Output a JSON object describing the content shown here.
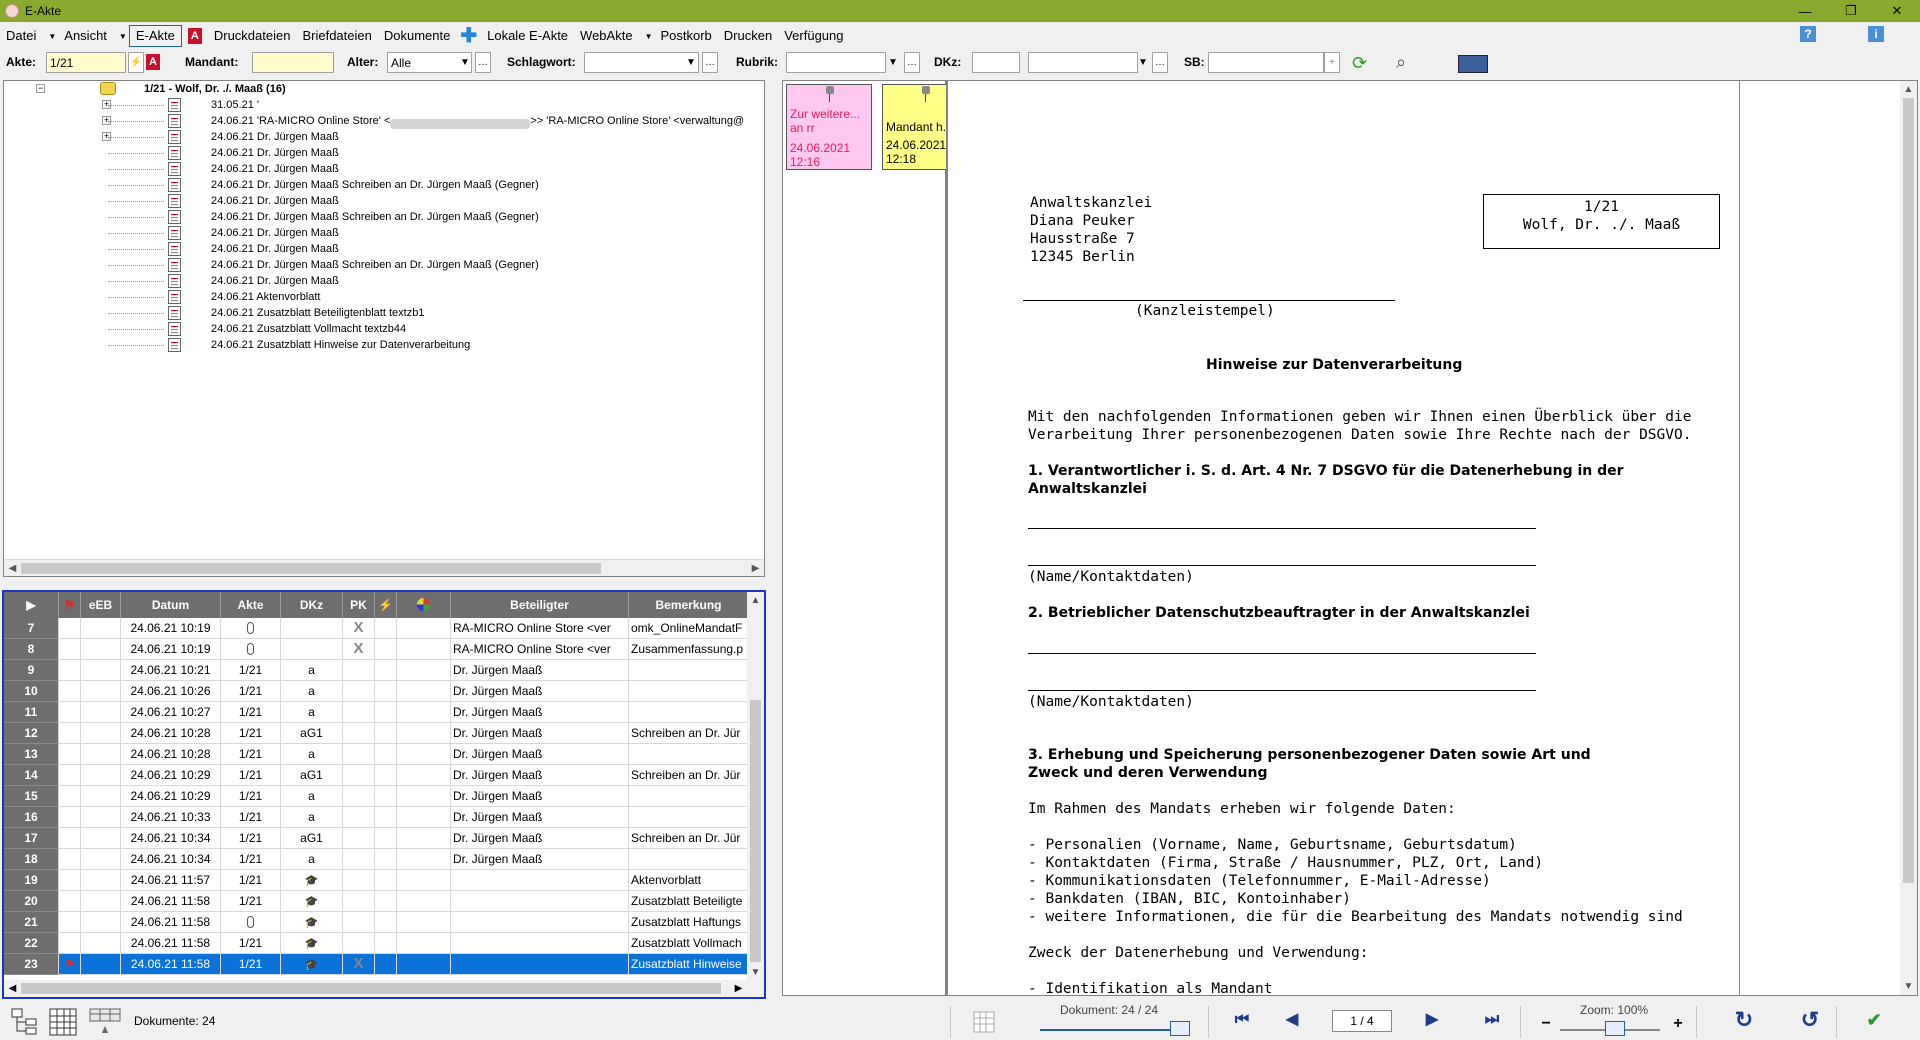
{
  "window": {
    "title": "E-Akte",
    "minimize": "—",
    "restore": "❐",
    "close": "✕"
  },
  "menu": {
    "datei": "Datei",
    "ansicht": "Ansicht",
    "eakte": "E-Akte",
    "druckdateien": "Druckdateien",
    "briefdateien": "Briefdateien",
    "dokumente": "Dokumente",
    "lokale_eakte": "Lokale E-Akte",
    "webakte": "WebAkte",
    "postkorb": "Postkorb",
    "drucken": "Drucken",
    "verfuegung": "Verfügung",
    "help": "?",
    "info": "i"
  },
  "filters": {
    "akte_label": "Akte:",
    "akte_value": "1/21",
    "mandant_label": "Mandant:",
    "mandant_value": "",
    "alter_label": "Alter:",
    "alter_value": "Alle",
    "schlagwort_label": "Schlagwort:",
    "schlagwort_value": "",
    "rubrik_label": "Rubrik:",
    "rubrik_value": "",
    "dkz_label": "DKz:",
    "dkz_value": "",
    "dkz2_value": "",
    "sb_label": "SB:",
    "sb_value": ""
  },
  "tree": {
    "root_label": "1/21 - Wolf, Dr. ./. Maaß (16)",
    "items": [
      {
        "date": "31.05.21",
        "text": "'",
        "expander": "+"
      },
      {
        "date": "24.06.21",
        "text": "'RA-MICRO Online Store' <",
        "text2": ">> 'RA-MICRO Online Store' <verwaltung@",
        "expander": "+"
      },
      {
        "date": "24.06.21",
        "text": "Dr. Jürgen Maaß",
        "expander": "+"
      },
      {
        "date": "24.06.21",
        "text": "Dr. Jürgen Maaß"
      },
      {
        "date": "24.06.21",
        "text": "Dr. Jürgen Maaß"
      },
      {
        "date": "24.06.21",
        "text": "Dr. Jürgen Maaß Schreiben an Dr. Jürgen Maaß (Gegner)"
      },
      {
        "date": "24.06.21",
        "text": "Dr. Jürgen Maaß"
      },
      {
        "date": "24.06.21",
        "text": "Dr. Jürgen Maaß Schreiben an Dr. Jürgen Maaß (Gegner)"
      },
      {
        "date": "24.06.21",
        "text": "Dr. Jürgen Maaß"
      },
      {
        "date": "24.06.21",
        "text": "Dr. Jürgen Maaß"
      },
      {
        "date": "24.06.21",
        "text": "Dr. Jürgen Maaß Schreiben an Dr. Jürgen Maaß (Gegner)"
      },
      {
        "date": "24.06.21",
        "text": "Dr. Jürgen Maaß"
      },
      {
        "date": "24.06.21",
        "text": "Aktenvorblatt"
      },
      {
        "date": "24.06.21",
        "text": "Zusatzblatt Beteiligtenblatt   textzb1"
      },
      {
        "date": "24.06.21",
        "text": "Zusatzblatt Vollmacht   textzb44"
      },
      {
        "date": "24.06.21",
        "text": "Zusatzblatt Hinweise zur Datenverarbeitung"
      }
    ]
  },
  "grid": {
    "headers": {
      "play": "▶",
      "eeb": "eEB",
      "datum": "Datum",
      "akte": "Akte",
      "dkz": "DKz",
      "pk": "PK",
      "beteiligter": "Beteiligter",
      "bemerkung": "Bemerkung"
    },
    "rows": [
      {
        "num": "7",
        "datum": "24.06.21 10:19",
        "akte": "",
        "akte_icon": "clip",
        "dkz": "",
        "pk": "X",
        "beteiligter": "RA-MICRO Online Store <ver",
        "bemerkung": "omk_OnlineMandatF"
      },
      {
        "num": "8",
        "datum": "24.06.21 10:19",
        "akte": "",
        "akte_icon": "clip",
        "dkz": "",
        "pk": "X",
        "beteiligter": "RA-MICRO Online Store <ver",
        "bemerkung": "Zusammenfassung.p"
      },
      {
        "num": "9",
        "datum": "24.06.21 10:21",
        "akte": "1/21",
        "dkz": "a",
        "pk": "",
        "beteiligter": "Dr. Jürgen Maaß",
        "bemerkung": ""
      },
      {
        "num": "10",
        "datum": "24.06.21 10:26",
        "akte": "1/21",
        "dkz": "a",
        "pk": "",
        "beteiligter": "Dr. Jürgen Maaß",
        "bemerkung": ""
      },
      {
        "num": "11",
        "datum": "24.06.21 10:27",
        "akte": "1/21",
        "dkz": "a",
        "pk": "",
        "beteiligter": "Dr. Jürgen Maaß",
        "bemerkung": ""
      },
      {
        "num": "12",
        "datum": "24.06.21 10:28",
        "akte": "1/21",
        "dkz": "aG1",
        "pk": "",
        "beteiligter": "Dr. Jürgen Maaß",
        "bemerkung": "Schreiben an Dr. Jür"
      },
      {
        "num": "13",
        "datum": "24.06.21 10:28",
        "akte": "1/21",
        "dkz": "a",
        "pk": "",
        "beteiligter": "Dr. Jürgen Maaß",
        "bemerkung": ""
      },
      {
        "num": "14",
        "datum": "24.06.21 10:29",
        "akte": "1/21",
        "dkz": "aG1",
        "pk": "",
        "beteiligter": "Dr. Jürgen Maaß",
        "bemerkung": "Schreiben an Dr. Jür"
      },
      {
        "num": "15",
        "datum": "24.06.21 10:29",
        "akte": "1/21",
        "dkz": "a",
        "pk": "",
        "beteiligter": "Dr. Jürgen Maaß",
        "bemerkung": ""
      },
      {
        "num": "16",
        "datum": "24.06.21 10:33",
        "akte": "1/21",
        "dkz": "a",
        "pk": "",
        "beteiligter": "Dr. Jürgen Maaß",
        "bemerkung": ""
      },
      {
        "num": "17",
        "datum": "24.06.21 10:34",
        "akte": "1/21",
        "dkz": "aG1",
        "pk": "",
        "beteiligter": "Dr. Jürgen Maaß",
        "bemerkung": "Schreiben an Dr. Jür"
      },
      {
        "num": "18",
        "datum": "24.06.21 10:34",
        "akte": "1/21",
        "dkz": "a",
        "pk": "",
        "beteiligter": "Dr. Jürgen Maaß",
        "bemerkung": ""
      },
      {
        "num": "19",
        "datum": "24.06.21 11:57",
        "akte": "1/21",
        "dkz": "",
        "dkz_icon": "hat",
        "pk": "",
        "beteiligter": "",
        "bemerkung": "Aktenvorblatt"
      },
      {
        "num": "20",
        "datum": "24.06.21 11:58",
        "akte": "1/21",
        "dkz": "",
        "dkz_icon": "hat",
        "pk": "",
        "beteiligter": "",
        "bemerkung": "Zusatzblatt Beteiligte"
      },
      {
        "num": "21",
        "datum": "24.06.21 11:58",
        "akte": "",
        "akte_icon": "clip",
        "dkz": "",
        "dkz_icon": "hat",
        "pk": "",
        "beteiligter": "",
        "bemerkung": "Zusatzblatt Haftungs"
      },
      {
        "num": "22",
        "datum": "24.06.21 11:58",
        "akte": "1/21",
        "dkz": "",
        "dkz_icon": "hat",
        "pk": "",
        "beteiligter": "",
        "bemerkung": "Zusatzblatt Vollmach"
      },
      {
        "num": "23",
        "datum": "24.06.21 11:58",
        "akte": "1/21",
        "dkz": "",
        "dkz_icon": "hat",
        "pk": "X",
        "beteiligter": "",
        "bemerkung": "Zusatzblatt Hinweise",
        "selected": true
      }
    ]
  },
  "status": {
    "documents": "Dokumente: 24"
  },
  "notes": [
    {
      "title": "Zur weitere... an rr",
      "date": "24.06.2021",
      "time": "12:16",
      "color": "#ffc8f0"
    },
    {
      "title": "Mandant h...",
      "date": "24.06.2021",
      "time": "12:18",
      "color": "#ffff88"
    }
  ],
  "document": {
    "sender": [
      "Anwaltskanzlei",
      "Diana Peuker",
      "Hausstraße 7",
      "12345 Berlin"
    ],
    "ref_number": "1/21",
    "ref_parties": "Wolf, Dr. ./. Maaß",
    "stamp": "(Kanzleistempel)",
    "heading": "Hinweise zur Datenverarbeitung",
    "intro1": "Mit den nachfolgenden Informationen geben wir Ihnen einen Überblick über die",
    "intro2": "Verarbeitung Ihrer personenbezogenen Daten sowie Ihre Rechte nach der DSGVO.",
    "s1_title1": "1. Verantwortlicher i. S. d. Art. 4 Nr. 7 DSGVO für die Datenerhebung in der",
    "s1_title2": "Anwaltskanzlei",
    "contact_label": "(Name/Kontaktdaten)",
    "s2_title": "2. Betrieblicher Datenschutzbeauftragter in der Anwaltskanzlei",
    "s3_title1": "3. Erhebung und Speicherung personenbezogener Daten sowie Art und",
    "s3_title2": "Zweck und deren Verwendung",
    "s3_intro": "Im Rahmen des Mandats erheben wir folgende Daten:",
    "s3_items": [
      "- Personalien (Vorname, Name, Geburtsname, Geburtsdatum)",
      "- Kontaktdaten (Firma, Straße / Hausnummer, PLZ, Ort, Land)",
      "- Kommunikationsdaten (Telefonnummer, E-Mail-Adresse)",
      "- Bankdaten (IBAN, BIC, Kontoinhaber)",
      "- weitere Informationen, die für die Bearbeitung des Mandats notwendig sind"
    ],
    "purpose_label": "Zweck der Datenerhebung und Verwendung:",
    "purpose_item": "- Identifikation als Mandant"
  },
  "nav": {
    "doc_label": "Dokument: 24 / 24",
    "page": "1 / 4",
    "zoom_label": "Zoom: 100%",
    "first": "⏮",
    "prev": "◀",
    "next": "▶",
    "last": "⏭",
    "zoom_minus": "−",
    "zoom_plus": "+",
    "redo": "↻",
    "undo": "↺",
    "confirm": "✔",
    "doc_progress": 1.0,
    "zoom_percent": 100
  },
  "colors": {
    "titlebar": "#8aaa2e",
    "selection": "#0a72d9",
    "grid_border": "#1c33c8"
  }
}
